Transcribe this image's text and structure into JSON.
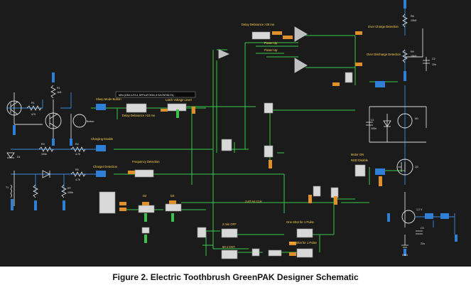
{
  "caption": "Figure 2. Electric Toothbrush GreenPAK Designer Schematic",
  "colors": {
    "background": "#1b1b1b",
    "wire": "#39c94a",
    "wire_blue": "#3a8ee6",
    "wire_white": "#d8d8d8",
    "pin_blue": "#2f7fd6",
    "pin_orange": "#e0902a",
    "pin_green": "#3cc24c",
    "label_yellow": "#ffd34a"
  },
  "labels": {
    "delay_top": "Delay Debounce >20 ms",
    "power_up": "Power Up",
    "power_up_2": "Power Up",
    "over_charge": "Over Charge Detection",
    "over_discharge": "Over Discharge Detection",
    "sleep_mode": "Sleep Mode Button",
    "hint_box": "MH4 (2/3/6 LUT/L3, DFF/LATCH3/4, 8 GA CNT/DLY/1)",
    "latch_voltage": "Latch Voltage Level",
    "delay_small": "Delay Debounce >10 ms",
    "button": "Button",
    "charging_enable": "Charging Enable",
    "charger_detection": "Charger Detection",
    "frequency_detection": "Frequency Detection",
    "motor_on": "Motor ON",
    "nsd_disable": "NSD Disable",
    "cdr": "2.6T Hz CLK",
    "one_shot_1": "One Shot for 1 Pulse",
    "one_shot_2": "One Shot for 1 Pulse",
    "two_min_off": "2 min OFF",
    "sixty_min": "50 s CNT",
    "d2": "D2",
    "d3": "D3",
    "r_top_a": "R8",
    "r_top_a_val": "10kΩ",
    "r_top_b": "R9",
    "r_top_b_val": "10kΩ",
    "r_left_a": "R1",
    "r_left_a_val": "470",
    "r_left_b": "R1",
    "r_left_b_val": "1kΩ",
    "r_mid_a": "R3",
    "r_mid_a_val": "100k",
    "r_mid_b": "R4",
    "r_mid_b_val": "4.7k",
    "r_low_a": "R5",
    "r_low_a_val": "4.7k",
    "r_low_b": "R7",
    "r_low_b_val": "100k",
    "c1": "C1",
    "c1_val": "100n",
    "c2": "C2",
    "c2_val": "10n",
    "c3": "C3",
    "c3_val": "22u",
    "motor": "M1",
    "q3": "Q3",
    "gnd": "GND",
    "v_label": "1.2 V",
    "t1": "T1",
    "d1": "D1"
  }
}
